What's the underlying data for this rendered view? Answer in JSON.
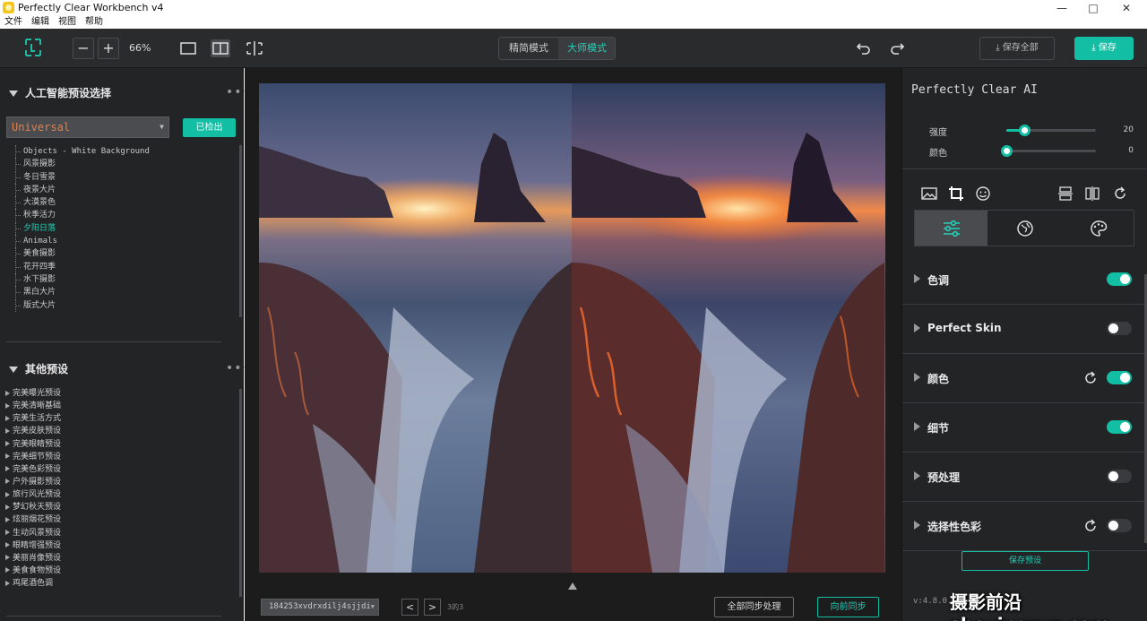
{
  "window": {
    "title": "Perfectly Clear Workbench v4",
    "minimize": "—",
    "maximize": "□",
    "close": "✕"
  },
  "menu": [
    "文件",
    "编辑",
    "视图",
    "帮助"
  ],
  "toolbar": {
    "zoom_out": "−",
    "zoom_in": "+",
    "zoom_level": "66%",
    "mode_simple": "精简模式",
    "mode_master": "大师模式",
    "save_all": "保存全部",
    "save": "保存"
  },
  "left_panel": {
    "ai_section_title": "人工智能预设选择",
    "ai_preset_value": "Universal",
    "detect_button": "已检出",
    "ai_tree": [
      "Objects - White Background",
      "风景摄影",
      "冬日雪景",
      "夜景大片",
      "大漠景色",
      "秋季活力",
      "夕阳日落",
      "Animals",
      "美食摄影",
      "花开四季",
      "水下摄影",
      "黑白大片",
      "版式大片"
    ],
    "ai_tree_active": "夕阳日落",
    "other_section_title": "其他预设",
    "other_presets": [
      "完美曝光预设",
      "完美清晰基础",
      "完美生活方式",
      "完美皮肤预设",
      "完美眼睛预设",
      "完美细节预设",
      "完美色彩预设",
      "户外摄影预设",
      "旅行风光预设",
      "梦幻秋天预设",
      "炫丽烟花预设",
      "生动风景预设",
      "眼睛增强预设",
      "美丽肖像预设",
      "美食食物预设",
      "鸡尾酒色调"
    ],
    "more": "•••"
  },
  "center": {
    "file_name": "184253xvdrxdilj4sjjdi",
    "prev": "<",
    "next": ">",
    "page_info": "3的3",
    "sync_all": "全部同步处理",
    "sync_forward": "向前同步"
  },
  "right_panel": {
    "title": "Perfectly Clear AI",
    "sliders": [
      {
        "label": "强度",
        "value": "20",
        "fraction": 0.2
      },
      {
        "label": "颜色",
        "value": "0",
        "fraction": 0.0
      }
    ],
    "sections": [
      {
        "label": "色调",
        "on": true,
        "reset": false
      },
      {
        "label": "Perfect Skin",
        "on": false,
        "reset": false
      },
      {
        "label": "颜色",
        "on": true,
        "reset": true
      },
      {
        "label": "细节",
        "on": true,
        "reset": false
      },
      {
        "label": "预处理",
        "on": false,
        "reset": false
      },
      {
        "label": "选择性色彩",
        "on": false,
        "reset": true
      }
    ],
    "save_preset": "保存预设",
    "version": "v:4.8.0."
  },
  "watermark": "摄影前沿sheyingzyz.com",
  "colors": {
    "accent": "#12bfa5",
    "panel": "#232426",
    "toolbar": "#2a2b2d",
    "preset_text": "#e2814a"
  }
}
